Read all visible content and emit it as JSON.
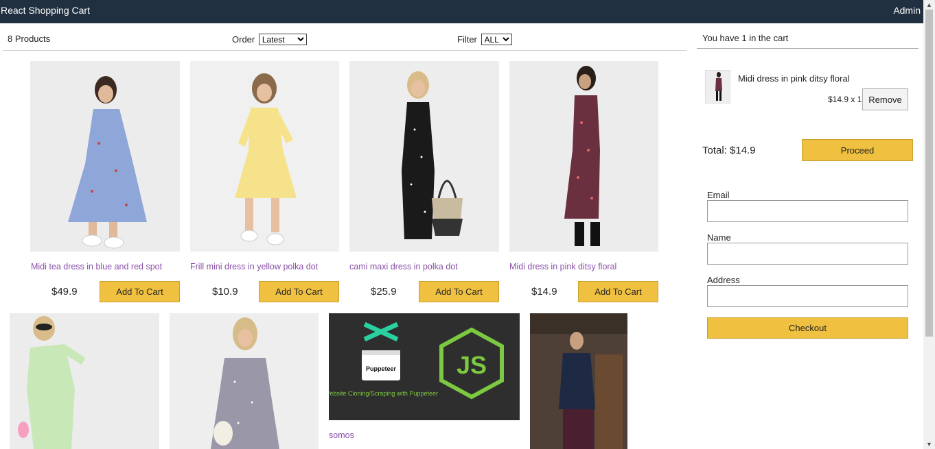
{
  "header": {
    "brand": "React Shopping Cart",
    "admin": "Admin"
  },
  "filter": {
    "count_label": "8 Products",
    "order_label": "Order",
    "order_value": "Latest",
    "filter_label": "Filter",
    "filter_value": "ALL"
  },
  "products": [
    {
      "name": "Midi tea dress in blue and red spot",
      "price": "$49.9",
      "button": "Add To Cart"
    },
    {
      "name": "Frill mini dress in yellow polka dot",
      "price": "$10.9",
      "button": "Add To Cart"
    },
    {
      "name": "cami maxi dress in polka dot",
      "price": "$25.9",
      "button": "Add To Cart"
    },
    {
      "name": "Midi dress in pink ditsy floral",
      "price": "$14.9",
      "button": "Add To Cart"
    },
    {
      "name": "",
      "price": "",
      "button": ""
    },
    {
      "name": "",
      "price": "",
      "button": ""
    },
    {
      "name": "somos",
      "price": "",
      "button": "",
      "image_caption": "Website Cloning/Scraping with Puppeteer",
      "image_logo_text": "Puppeteer",
      "image_badge": "JS"
    },
    {
      "name": "",
      "price": "",
      "button": ""
    }
  ],
  "cart": {
    "header": "You have 1 in the cart",
    "item_name": "Midi dress in pink ditsy floral",
    "item_qty": "$14.9 x 1",
    "remove_label": "Remove",
    "total": "Total: $14.9",
    "proceed_label": "Proceed",
    "email_label": "Email",
    "name_label": "Name",
    "address_label": "Address",
    "checkout_label": "Checkout"
  },
  "colors": {
    "header_bg": "#203040",
    "accent": "#f0c040",
    "product_name": "#8a4fa8"
  }
}
